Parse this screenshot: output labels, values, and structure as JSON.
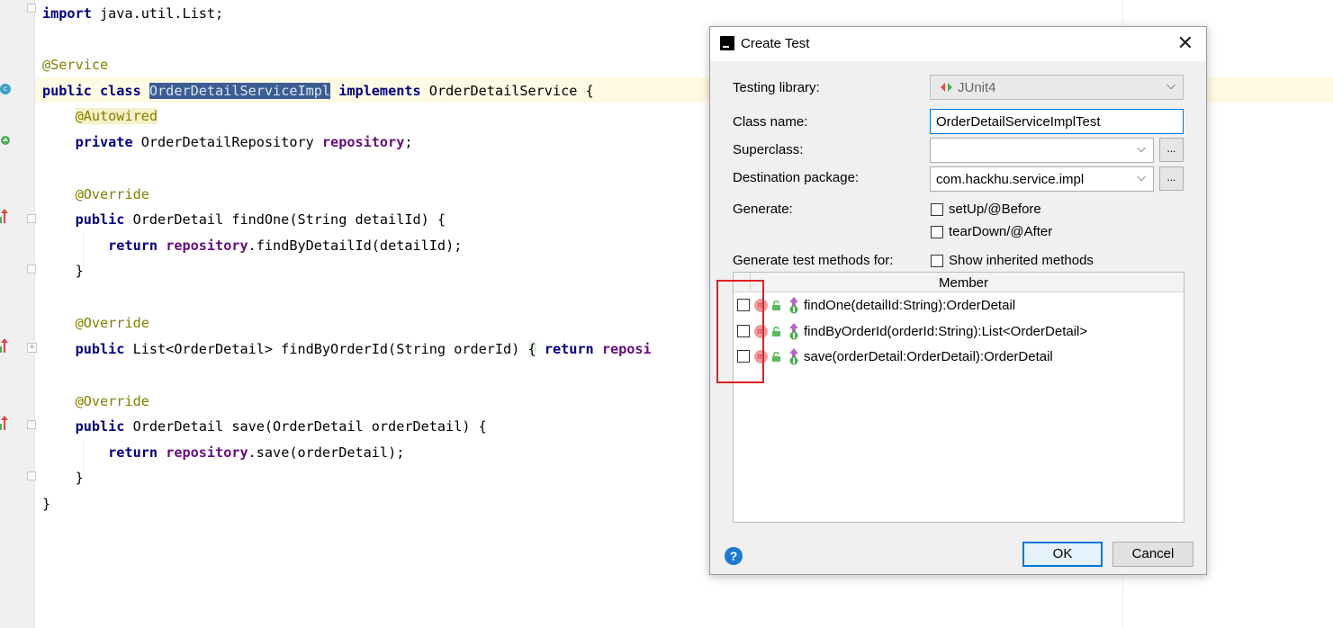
{
  "editor": {
    "lines": [
      {
        "id": "l1",
        "parts": [
          {
            "t": "import",
            "c": "kw"
          },
          {
            "t": " java.util.List;"
          }
        ]
      },
      {
        "id": "l2",
        "parts": [
          {
            "t": "@Service",
            "c": "ann"
          }
        ]
      },
      {
        "id": "l3",
        "parts": [
          {
            "t": "public class",
            "c": "kw"
          },
          {
            "t": " "
          },
          {
            "t": "OrderDetailServiceImpl",
            "c": "sel"
          },
          {
            "t": " "
          },
          {
            "t": "implements",
            "c": "kw"
          },
          {
            "t": " OrderDetailService {"
          }
        ]
      },
      {
        "id": "l4",
        "parts": [
          {
            "t": "    "
          },
          {
            "t": "@Autowired",
            "c": "ann-bg"
          }
        ]
      },
      {
        "id": "l5",
        "parts": [
          {
            "t": "    "
          },
          {
            "t": "private",
            "c": "kw"
          },
          {
            "t": " OrderDetailRepository "
          },
          {
            "t": "repository",
            "c": "fld"
          },
          {
            "t": ";"
          }
        ]
      },
      {
        "id": "l6",
        "parts": [
          {
            "t": "    "
          },
          {
            "t": "@Override",
            "c": "ann"
          }
        ]
      },
      {
        "id": "l7",
        "parts": [
          {
            "t": "    "
          },
          {
            "t": "public",
            "c": "kw"
          },
          {
            "t": " OrderDetail findOne(String detailId) {"
          }
        ]
      },
      {
        "id": "l8",
        "parts": [
          {
            "t": "        "
          },
          {
            "t": "return",
            "c": "kw"
          },
          {
            "t": " "
          },
          {
            "t": "repository",
            "c": "fld"
          },
          {
            "t": ".findByDetailId(detailId);"
          }
        ]
      },
      {
        "id": "l9",
        "parts": [
          {
            "t": "    }"
          }
        ]
      },
      {
        "id": "l10",
        "parts": [
          {
            "t": "    "
          },
          {
            "t": "@Override",
            "c": "ann"
          }
        ]
      },
      {
        "id": "l11",
        "parts": [
          {
            "t": "    "
          },
          {
            "t": "public",
            "c": "kw"
          },
          {
            "t": " List<OrderDetail> findByOrderId(String orderId) "
          },
          {
            "t": "{",
            "c": "brace-box"
          },
          {
            "t": " "
          },
          {
            "t": "return",
            "c": "kw"
          },
          {
            "t": " "
          },
          {
            "t": "reposi",
            "c": "fld"
          }
        ]
      },
      {
        "id": "l12",
        "parts": [
          {
            "t": "    "
          },
          {
            "t": "@Override",
            "c": "ann"
          }
        ]
      },
      {
        "id": "l13",
        "parts": [
          {
            "t": "    "
          },
          {
            "t": "public",
            "c": "kw"
          },
          {
            "t": " OrderDetail save(OrderDetail orderDetail) {"
          }
        ]
      },
      {
        "id": "l14",
        "parts": [
          {
            "t": "        "
          },
          {
            "t": "return",
            "c": "kw"
          },
          {
            "t": " "
          },
          {
            "t": "repository",
            "c": "fld"
          },
          {
            "t": ".save(orderDetail);"
          }
        ]
      },
      {
        "id": "l15",
        "parts": [
          {
            "t": "    }"
          }
        ]
      },
      {
        "id": "l16",
        "parts": [
          {
            "t": "}"
          }
        ]
      }
    ]
  },
  "dialog": {
    "title": "Create Test",
    "close_glyph": "✕",
    "testing_library_label": "Testing library:",
    "testing_library_value": "JUnit4",
    "class_name_label": "Class name:",
    "class_name_value": "OrderDetailServiceImplTest",
    "superclass_label": "Superclass:",
    "superclass_value": "",
    "destination_package_label": "Destination package:",
    "destination_package_value": "com.hackhu.service.impl",
    "browse_label": "...",
    "generate_label": "Generate:",
    "setup_label": "setUp/@Before",
    "teardown_label": "tearDown/@After",
    "generate_methods_label": "Generate test methods for:",
    "show_inherited_label": "Show inherited methods",
    "member_header": "Member",
    "members": [
      {
        "signature": "findOne(detailId:String):OrderDetail",
        "checked": false
      },
      {
        "signature": "findByOrderId(orderId:String):List<OrderDetail>",
        "checked": false
      },
      {
        "signature": "save(orderDetail:OrderDetail):OrderDetail",
        "checked": false
      }
    ],
    "method_icon_letter": "m",
    "help_glyph": "?",
    "ok_label": "OK",
    "cancel_label": "Cancel"
  }
}
